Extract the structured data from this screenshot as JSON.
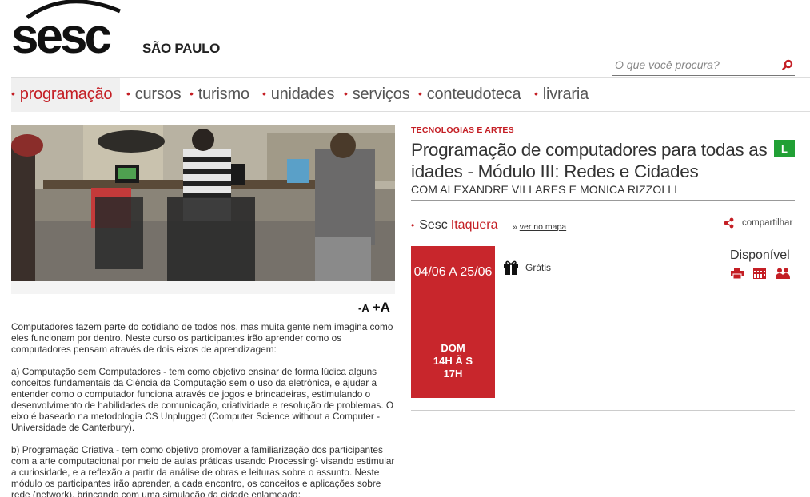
{
  "header": {
    "logo_text": "sesc",
    "region": "SÃO PAULO",
    "search_placeholder": "O que você procura?"
  },
  "nav": {
    "items": [
      {
        "label": "programação",
        "active": true
      },
      {
        "label": "cursos"
      },
      {
        "label": "turismo"
      },
      {
        "label": "unidades"
      },
      {
        "label": "serviços"
      },
      {
        "label": "conteudoteca"
      },
      {
        "label": "livraria"
      }
    ]
  },
  "font_control": {
    "smaller": "-A",
    "bigger": "+A"
  },
  "description": [
    "Computadores fazem parte do cotidiano de todos nós, mas muita gente nem imagina como eles funcionam por dentro. Neste curso os participantes irão aprender como os computadores pensam através de dois eixos de aprendizagem:",
    "a) Computação sem Computadores - tem como objetivo ensinar de forma lúdica alguns conceitos fundamentais da Ciência da Computação sem o uso da eletrônica, e ajudar a entender como o computador funciona através de jogos e brincadeiras, estimulando o desenvolvimento de habilidades de comunicação, criatividade e resolução de problemas. O eixo é baseado na metodologia CS Unplugged (Computer Science without a Computer - Universidade de Canterbury).",
    "b) Programação Criativa - tem como objetivo promover a familiarização dos participantes com a arte computacional por meio de aulas práticas usando Processing¹ visando estimular a curiosidade, e a reflexão a partir da análise de obras e leituras sobre o assunto. Neste módulo os participantes irão aprender, a cada encontro, os conceitos e aplicações sobre rede (network), brincando com uma simulação da cidade enlameada;"
  ],
  "event": {
    "category": "TECNOLOGIAS E ARTES",
    "title": "Programação de computadores para todas as idades - Módulo III: Redes e Cidades",
    "rating_badge": "L",
    "subtitle": "COM ALEXANDRE VILLARES E MONICA RIZZOLLI",
    "unit_prefix": "Sesc",
    "unit_name": "Itaquera",
    "map_prefix": "»",
    "map_link": "ver no mapa",
    "share": "compartilhar",
    "date_range": "04/06 A 25/06",
    "schedule_day": "DOM",
    "schedule_time": "14H Ã S 17H",
    "price": "Grátis",
    "availability": "Disponível"
  },
  "colors": {
    "brand_red": "#c41e24",
    "date_box": "#c8262c",
    "rating_green": "#21a035"
  }
}
